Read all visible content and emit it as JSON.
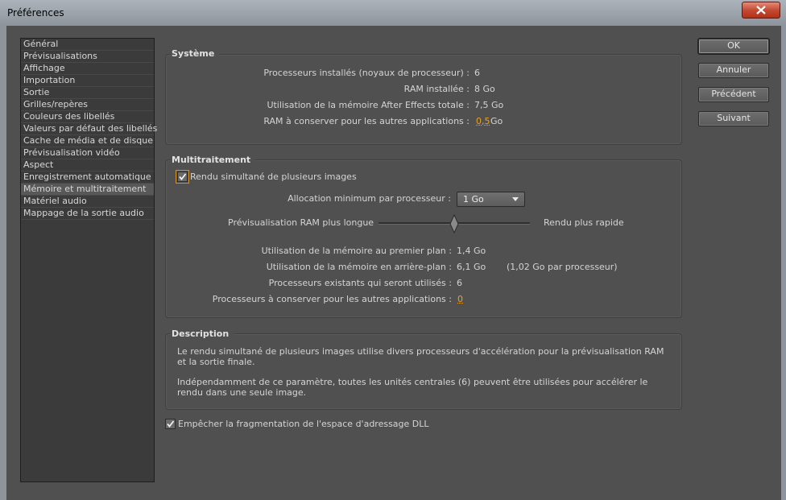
{
  "window": {
    "title": "Préférences"
  },
  "nav": {
    "selected_index": 13,
    "items": [
      "Général",
      "Prévisualisations",
      "Affichage",
      "Importation",
      "Sortie",
      "Grilles/repères",
      "Couleurs des libellés",
      "Valeurs par défaut des libellés",
      "Cache de média et de disque",
      "Prévisualisation vidéo",
      "Aspect",
      "Enregistrement automatique",
      "Mémoire et multitraitement",
      "Matériel audio",
      "Mappage de la sortie audio"
    ]
  },
  "buttons": {
    "ok": "OK",
    "cancel": "Annuler",
    "previous": "Précédent",
    "next": "Suivant"
  },
  "system": {
    "title": "Système",
    "rows": [
      {
        "label": "Processeurs installés (noyaux de processeur) :",
        "value": "6"
      },
      {
        "label": "RAM installée :",
        "value": "8 Go"
      },
      {
        "label": "Utilisation de la mémoire After Effects totale :",
        "value": "7,5 Go"
      },
      {
        "label": "RAM à conserver pour les autres applications :",
        "value": "0,5",
        "unit": "Go"
      }
    ]
  },
  "multi": {
    "title": "Multitraitement",
    "render_multiple": {
      "label": "Rendu simultané de plusieurs images",
      "checked": true
    },
    "allocation": {
      "label": "Allocation minimum par processeur :",
      "value": "1 Go"
    },
    "slider": {
      "left_label": "Prévisualisation RAM plus longue",
      "right_label": "Rendu plus rapide",
      "position": 0.5
    },
    "rows": [
      {
        "label": "Utilisation de la mémoire au premier plan :",
        "value": "1,4 Go"
      },
      {
        "label": "Utilisation de la mémoire en arrière-plan :",
        "value": "6,1 Go",
        "extra": "(1,02 Go par processeur)"
      },
      {
        "label": "Processeurs existants qui seront utilisés :",
        "value": "6"
      },
      {
        "label": "Processeurs à conserver pour les autres applications :",
        "value": "0"
      }
    ]
  },
  "description": {
    "title": "Description",
    "paragraph1": "Le rendu simultané de plusieurs images utilise divers processeurs d'accélération pour la prévisualisation RAM et la sortie finale.",
    "paragraph2": "Indépendamment de ce paramètre, toutes les unités centrales (6) peuvent être utilisées pour accélérer le rendu dans une seule image."
  },
  "dll": {
    "label": "Empêcher la fragmentation  de l'espace d'adressage DLL",
    "checked": true
  },
  "colors": {
    "accent": "#e8a12a",
    "panel_bg": "#505050",
    "list_bg": "#3b3b3b"
  }
}
